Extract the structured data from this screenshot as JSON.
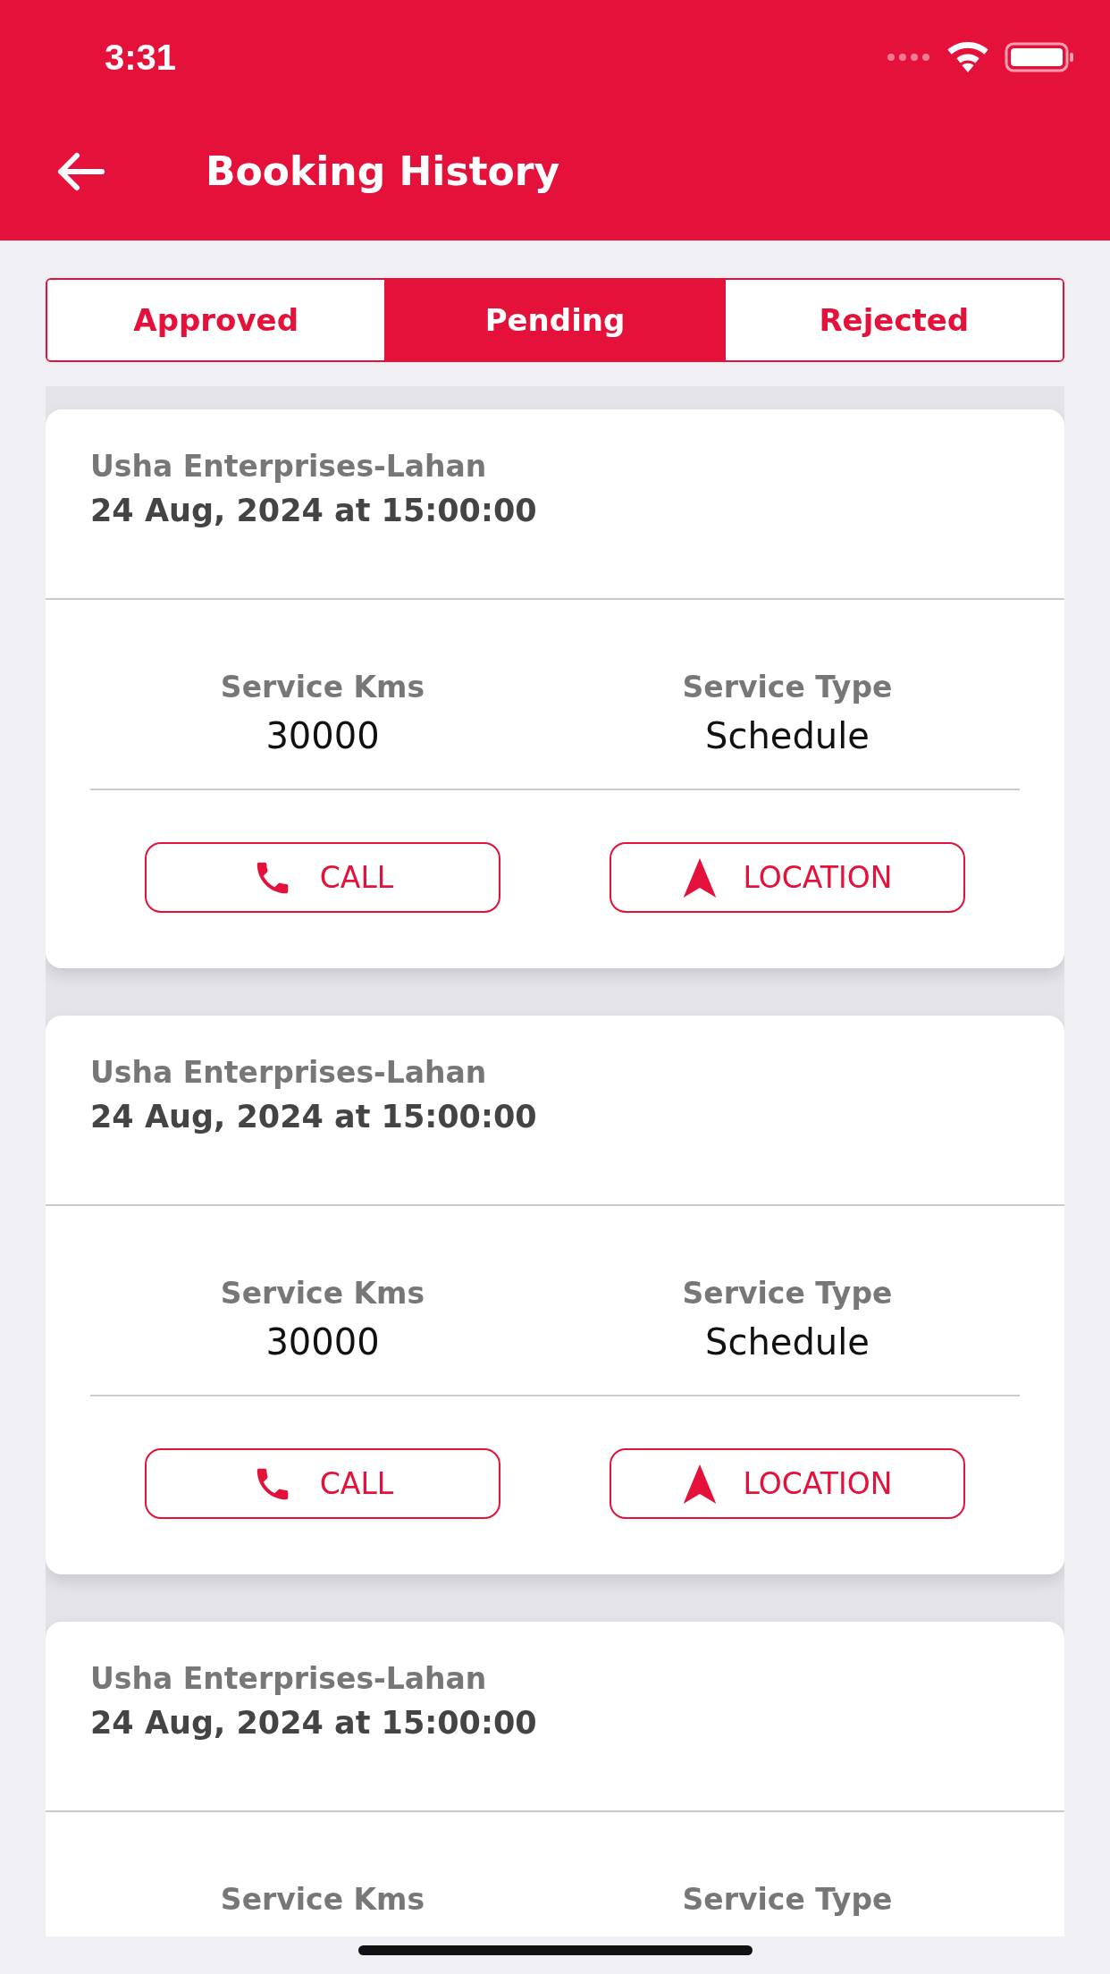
{
  "status_bar": {
    "time": "3:31"
  },
  "header": {
    "title": "Booking History"
  },
  "tabs": [
    {
      "label": "Approved",
      "selected": false
    },
    {
      "label": "Pending",
      "selected": true
    },
    {
      "label": "Rejected",
      "selected": false
    }
  ],
  "bookings": [
    {
      "dealer": "Usha Enterprises-Lahan",
      "datetime": "24 Aug, 2024 at 15:00:00",
      "fields": [
        {
          "label": "Service Kms",
          "value": "30000"
        },
        {
          "label": "Service Type",
          "value": "Schedule"
        }
      ],
      "actions": [
        {
          "kind": "call",
          "label": "CALL"
        },
        {
          "kind": "location",
          "label": "LOCATION"
        }
      ]
    },
    {
      "dealer": "Usha Enterprises-Lahan",
      "datetime": "24 Aug, 2024 at 15:00:00",
      "fields": [
        {
          "label": "Service Kms",
          "value": "30000"
        },
        {
          "label": "Service Type",
          "value": "Schedule"
        }
      ],
      "actions": [
        {
          "kind": "call",
          "label": "CALL"
        },
        {
          "kind": "location",
          "label": "LOCATION"
        }
      ]
    },
    {
      "dealer": "Usha Enterprises-Lahan",
      "datetime": "24 Aug, 2024 at 15:00:00",
      "fields": [
        {
          "label": "Service Kms"
        },
        {
          "label": "Service Type"
        }
      ]
    }
  ]
}
